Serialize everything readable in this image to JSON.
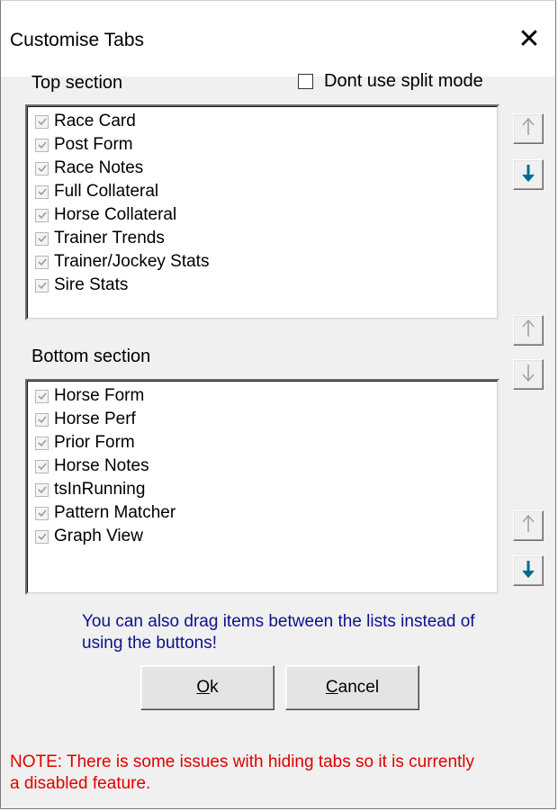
{
  "window": {
    "title": "Customise Tabs",
    "close_glyph": "✕"
  },
  "top": {
    "label": "Top section",
    "split_checkbox_label": "Dont use split mode",
    "split_checked": false,
    "items": [
      {
        "label": "Race Card",
        "checked": true
      },
      {
        "label": "Post Form",
        "checked": true
      },
      {
        "label": "Race Notes",
        "checked": true
      },
      {
        "label": "Full Collateral",
        "checked": true
      },
      {
        "label": "Horse Collateral",
        "checked": true
      },
      {
        "label": "Trainer Trends",
        "checked": true
      },
      {
        "label": "Trainer/Jockey Stats",
        "checked": true
      },
      {
        "label": "Sire Stats",
        "checked": true
      }
    ]
  },
  "bottom": {
    "label": "Bottom section",
    "items": [
      {
        "label": "Horse Form",
        "checked": true
      },
      {
        "label": "Horse Perf",
        "checked": true
      },
      {
        "label": "Prior Form",
        "checked": true
      },
      {
        "label": "Horse Notes",
        "checked": true
      },
      {
        "label": "tsInRunning",
        "checked": true
      },
      {
        "label": "Pattern Matcher",
        "checked": true
      },
      {
        "label": "Graph View",
        "checked": true
      }
    ]
  },
  "buttons": {
    "top_up": {
      "icon": "arrow-up-icon",
      "enabled": false
    },
    "top_down": {
      "icon": "arrow-down-icon",
      "enabled": true
    },
    "move_up": {
      "icon": "arrow-up-icon",
      "enabled": false
    },
    "move_down": {
      "icon": "arrow-down-icon",
      "enabled": false
    },
    "bottom_up": {
      "icon": "arrow-up-icon",
      "enabled": false
    },
    "bottom_down": {
      "icon": "arrow-down-icon",
      "enabled": true
    },
    "ok_mnemonic": "O",
    "ok_rest": "k",
    "cancel_mnemonic": "C",
    "cancel_rest": "ancel"
  },
  "hint": "You can also drag items between the lists instead of using the buttons!",
  "note": "NOTE: There is some issues with hiding tabs so it is currently a disabled feature.",
  "colors": {
    "hint": "#10108c",
    "note": "#e00000",
    "arrow_enabled": "#006b8f",
    "arrow_disabled": "#a0a0a0"
  }
}
